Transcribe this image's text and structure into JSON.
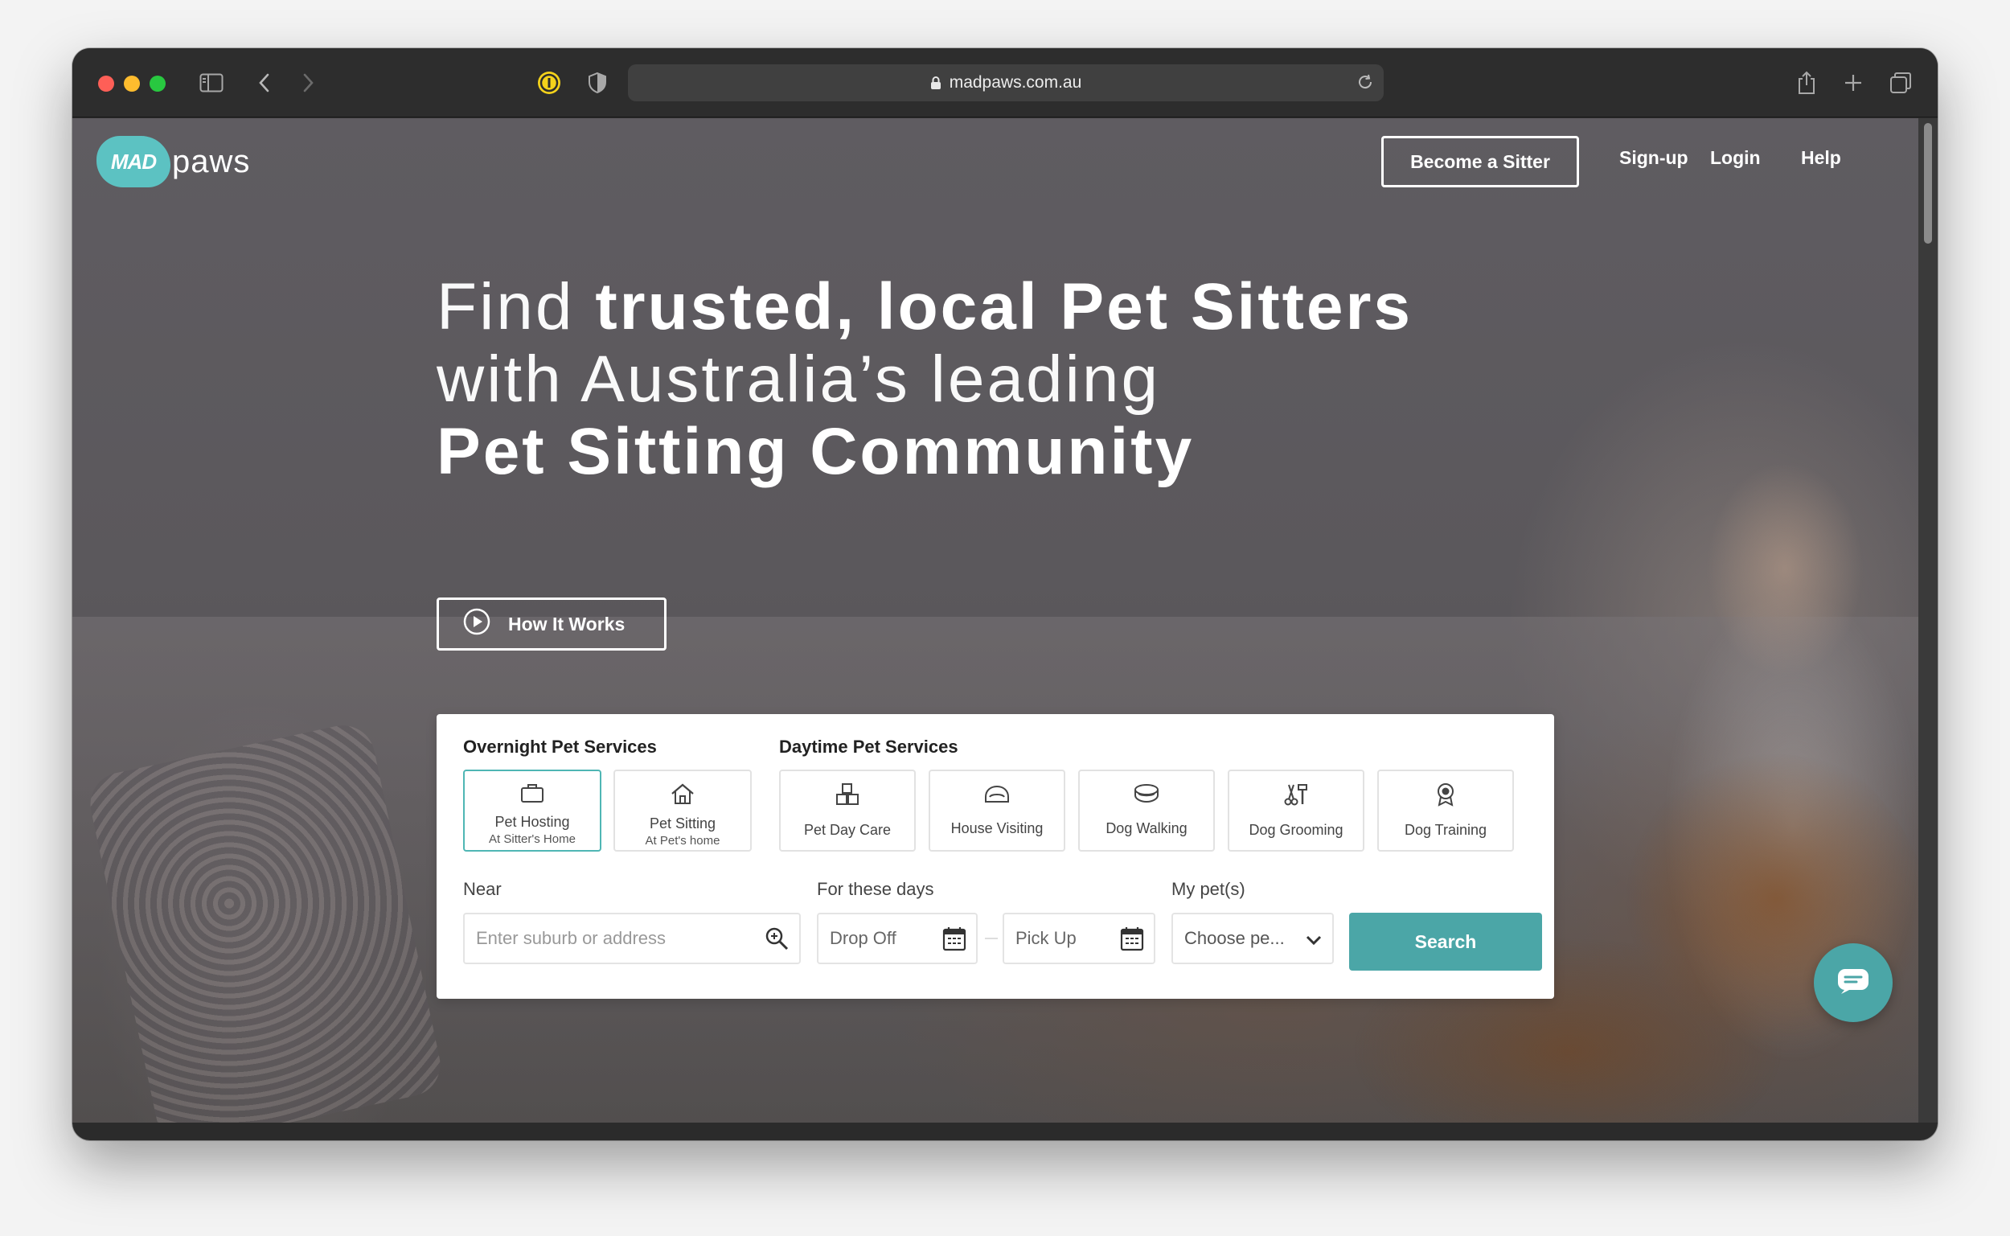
{
  "browser": {
    "url": "madpaws.com.au"
  },
  "nav": {
    "logo_mark": "MAD",
    "logo_text": "paws",
    "become_sitter": "Become a Sitter",
    "signup": "Sign-up",
    "login": "Login",
    "help": "Help"
  },
  "hero": {
    "line1_light": "Find ",
    "line1_bold": "trusted, local Pet Sitters",
    "line2": "with Australia’s leading",
    "line3": "Pet Sitting Community",
    "how_it_works": "How It Works"
  },
  "search": {
    "overnight_title": "Overnight Pet Services",
    "daytime_title": "Daytime Pet Services",
    "overnight": [
      {
        "label": "Pet Hosting",
        "sub": "At Sitter's Home",
        "icon": "briefcase-icon"
      },
      {
        "label": "Pet Sitting",
        "sub": "At Pet's home",
        "icon": "house-icon"
      }
    ],
    "daytime": [
      {
        "label": "Pet Day Care",
        "icon": "blocks-icon"
      },
      {
        "label": "House Visiting",
        "icon": "pet-bed-icon"
      },
      {
        "label": "Dog Walking",
        "icon": "bowl-icon"
      },
      {
        "label": "Dog Grooming",
        "icon": "grooming-icon"
      },
      {
        "label": "Dog Training",
        "icon": "award-icon"
      }
    ],
    "near_label": "Near",
    "near_placeholder": "Enter suburb or address",
    "days_label": "For these days",
    "drop_off": "Drop Off",
    "pick_up": "Pick Up",
    "pets_label": "My pet(s)",
    "pets_value": "Choose pe...",
    "search_button": "Search"
  },
  "colors": {
    "accent": "#4ba6a7",
    "active_border": "#4fb6b4"
  }
}
